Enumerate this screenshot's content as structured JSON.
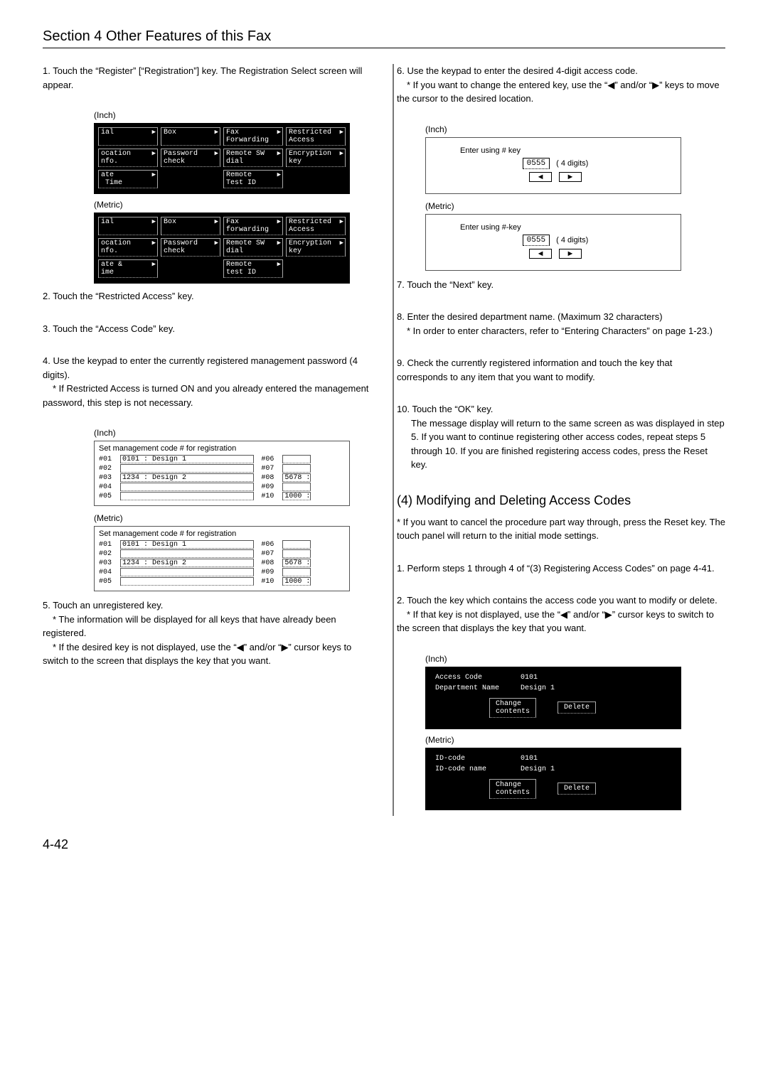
{
  "section_title": "Section 4 Other Features of this Fax",
  "left": {
    "step1": "1. Touch the “Register” [“Registration”] key. The Registration Select screen will appear.",
    "label_inch": "(Inch)",
    "label_metric": "(Metric)",
    "panel1_inch": {
      "r1": [
        "ial",
        "Box",
        "Fax\nForwarding",
        "Restricted\nAccess"
      ],
      "r2": [
        "ocation\nnfo.",
        "Password\ncheck",
        "Remote SW\ndial",
        "Encryption\nkey"
      ],
      "r3": [
        "ate\n Time",
        "",
        "Remote\nTest ID",
        ""
      ]
    },
    "panel1_metric": {
      "r1": [
        "ial",
        "Box",
        "Fax\nforwarding",
        "Restricted\nAccess"
      ],
      "r2": [
        "ocation\nnfo.",
        "Password\ncheck",
        "Remote SW\ndial",
        "Encryption\nkey"
      ],
      "r3": [
        "ate &\nime",
        "",
        "Remote\ntest ID",
        ""
      ]
    },
    "step2": "2. Touch the “Restricted Access” key.",
    "step3": "3. Touch the “Access Code” key.",
    "step4": "4. Use the keypad to enter the currently registered management password (4 digits).",
    "step4_sub": "* If Restricted Access is turned ON and you already entered the management password, this step is not necessary.",
    "wp_title": "Set management code # for registration",
    "wp_rows_left": [
      "#01",
      "#02",
      "#03",
      "#04",
      "#05"
    ],
    "wp_rows_right": [
      "#06",
      "#07",
      "#08",
      "#09",
      "#10"
    ],
    "wp_val_01": "0101 : Design 1",
    "wp_val_03": "1234 : Design 2",
    "wp_val_08": "5678 :",
    "wp_val_10": "1000 :",
    "step5": "5. Touch an unregistered key.",
    "step5_sub1": "* The information will be displayed for all keys that have already been registered.",
    "step5_sub2": "* If the desired key is not displayed, use the “◀” and/or “▶” cursor keys to switch to the screen that displays the key that you want."
  },
  "right": {
    "step6": "6. Use the keypad to enter the desired 4-digit access code.",
    "step6_sub": "* If you want to change the entered key, use the “◀” and/or “▶” keys to move the cursor to the desired location.",
    "rbox_inch_title": "Enter using # key",
    "rbox_metric_title": "Enter using #-key",
    "rbox_digits": "0555",
    "rbox_digits_label": "( 4 digits)",
    "step7": "7. Touch the “Next” key.",
    "step8": "8. Enter the desired department name. (Maximum 32 characters)",
    "step8_sub": "* In order to enter characters, refer to “Entering Characters” on page 1-23.)",
    "step9": "9. Check the currently registered information and touch the key that corresponds to any item that you want to modify.",
    "step10": "10. Touch the “OK” key.",
    "step10_body": "The message display will return to the same screen as was displayed in step 5. If you want to continue registering other access codes, repeat steps 5 through 10. If you are finished registering access codes, press the Reset key.",
    "h2": "(4) Modifying and Deleting Access Codes",
    "h2_sub": "* If you want to cancel the procedure part way through, press the Reset key. The touch panel will return to the initial mode settings.",
    "m_step1": "1. Perform steps 1 through 4 of “(3) Registering Access Codes” on page 4-41.",
    "m_step2": "2. Touch the key which contains the access code you want to modify or delete.",
    "m_step2_sub": "* If that key is not displayed, use the “◀” and/or “▶” cursor keys to switch to the screen that displays the key that you want.",
    "dp_inch": {
      "l1": "Access Code",
      "v1": "0101",
      "l2": "Department Name",
      "v2": "Design 1",
      "b1": "Change\ncontents",
      "b2": "Delete"
    },
    "dp_metric": {
      "l1": "ID-code",
      "v1": "0101",
      "l2": "ID-code name",
      "v2": "Design 1",
      "b1": "Change\ncontents",
      "b2": "Delete"
    }
  },
  "pagenum": "4-42"
}
